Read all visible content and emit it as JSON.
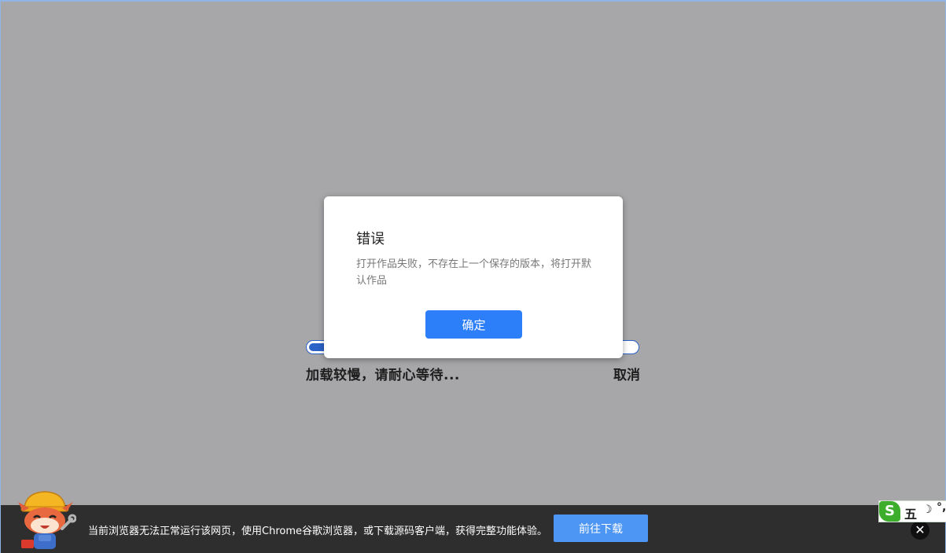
{
  "loading": {
    "text": "加载较慢，请耐心等待...",
    "cancel_label": "取消",
    "progress_fraction": 0.08
  },
  "dialog": {
    "title": "错误",
    "message": "打开作品失败，不存在上一个保存的版本，将打开默认作品",
    "ok_label": "确定"
  },
  "banner": {
    "text": "当前浏览器无法正常运行该网页，使用Chrome谷歌浏览器，或下载源码客户端，获得完整功能体验。",
    "download_label": "前往下载",
    "close_glyph": "✕"
  },
  "ime": {
    "logo_glyph": "S",
    "mode_label": "五",
    "moon_glyph": "☽",
    "punct_glyph": "°,"
  },
  "colors": {
    "accent": "#2d7ff9",
    "progress": "#2b63c8",
    "overlay": "#a7a7a9",
    "banner_bg": "#2e2e2e"
  }
}
